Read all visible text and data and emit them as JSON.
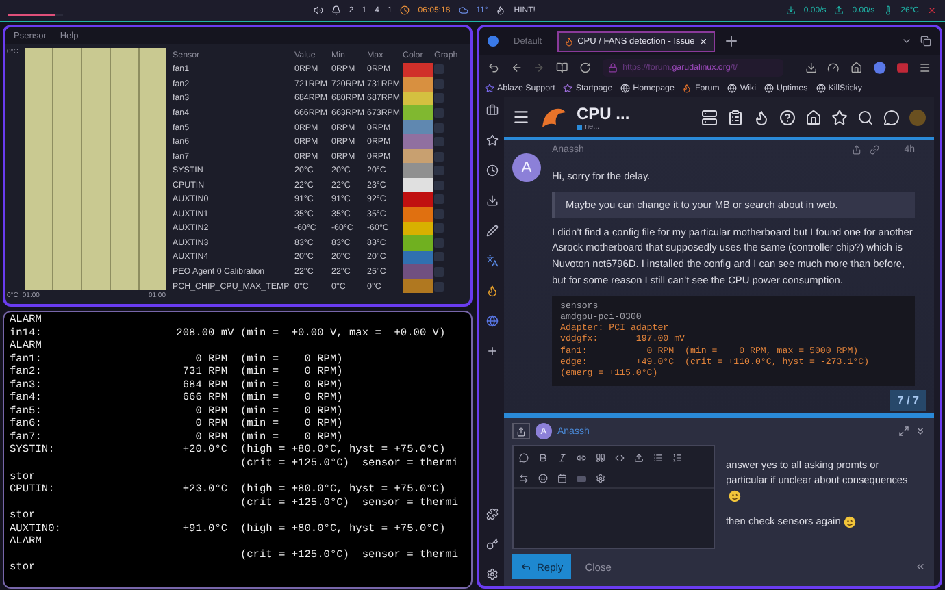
{
  "top_bar": {
    "progress": {
      "level": 0.85
    },
    "workspaces": [
      "2",
      "1",
      "4",
      "1"
    ],
    "clock": "06:05:18",
    "weather": "11°",
    "hint": "HINT!",
    "net_down": "0.00/s",
    "net_up": "0.00/s",
    "temperature": "26°C"
  },
  "psensor": {
    "menu": [
      "Psensor",
      "Help"
    ],
    "graph": {
      "y_top": "0°C",
      "y_bottom": "0°C",
      "x_start": "01:00",
      "x_end": "01:00"
    },
    "columns": [
      "Sensor",
      "Value",
      "Min",
      "Max",
      "Color",
      "Graph"
    ],
    "rows": [
      {
        "sensor": "fan1",
        "value": "0RPM",
        "min": "0RPM",
        "max": "0RPM",
        "color": "#d0302a",
        "graph": false
      },
      {
        "sensor": "fan2",
        "value": "721RPM",
        "min": "720RPM",
        "max": "731RPM",
        "color": "#d89040",
        "graph": false
      },
      {
        "sensor": "fan3",
        "value": "684RPM",
        "min": "680RPM",
        "max": "687RPM",
        "color": "#d4c040",
        "graph": false
      },
      {
        "sensor": "fan4",
        "value": "666RPM",
        "min": "663RPM",
        "max": "673RPM",
        "color": "#80b830",
        "graph": false
      },
      {
        "sensor": "fan5",
        "value": "0RPM",
        "min": "0RPM",
        "max": "0RPM",
        "color": "#6088b0",
        "graph": false
      },
      {
        "sensor": "fan6",
        "value": "0RPM",
        "min": "0RPM",
        "max": "0RPM",
        "color": "#9070a0",
        "graph": false
      },
      {
        "sensor": "fan7",
        "value": "0RPM",
        "min": "0RPM",
        "max": "0RPM",
        "color": "#c8a070",
        "graph": false
      },
      {
        "sensor": "SYSTIN",
        "value": "20°C",
        "min": "20°C",
        "max": "20°C",
        "color": "#909090",
        "graph": false
      },
      {
        "sensor": "CPUTIN",
        "value": "22°C",
        "min": "22°C",
        "max": "23°C",
        "color": "#e0e0e0",
        "graph": false
      },
      {
        "sensor": "AUXTIN0",
        "value": "91°C",
        "min": "91°C",
        "max": "92°C",
        "color": "#c01010",
        "graph": false
      },
      {
        "sensor": "AUXTIN1",
        "value": "35°C",
        "min": "35°C",
        "max": "35°C",
        "color": "#e07010",
        "graph": false
      },
      {
        "sensor": "AUXTIN2",
        "value": "-60°C",
        "min": "-60°C",
        "max": "-60°C",
        "color": "#d8b000",
        "graph": false
      },
      {
        "sensor": "AUXTIN3",
        "value": "83°C",
        "min": "83°C",
        "max": "83°C",
        "color": "#70b020",
        "graph": false
      },
      {
        "sensor": "AUXTIN4",
        "value": "20°C",
        "min": "20°C",
        "max": "20°C",
        "color": "#3070b0",
        "graph": false
      },
      {
        "sensor": "PEO Agent 0 Calibration",
        "value": "22°C",
        "min": "22°C",
        "max": "25°C",
        "color": "#705080",
        "graph": false
      },
      {
        "sensor": "PCH_CHIP_CPU_MAX_TEMP",
        "value": "0°C",
        "min": "0°C",
        "max": "0°C",
        "color": "#b07820",
        "graph": false
      }
    ]
  },
  "terminal": {
    "lines": [
      "ALARM",
      "in14:                     208.00 mV (min =  +0.00 V, max =  +0.00 V)",
      "ALARM",
      "fan1:                        0 RPM  (min =    0 RPM)",
      "fan2:                      731 RPM  (min =    0 RPM)",
      "fan3:                      684 RPM  (min =    0 RPM)",
      "fan4:                      666 RPM  (min =    0 RPM)",
      "fan5:                        0 RPM  (min =    0 RPM)",
      "fan6:                        0 RPM  (min =    0 RPM)",
      "fan7:                        0 RPM  (min =    0 RPM)",
      "SYSTIN:                    +20.0°C  (high = +80.0°C, hyst = +75.0°C)",
      "                                    (crit = +125.0°C)  sensor = thermi",
      "stor",
      "CPUTIN:                    +23.0°C  (high = +80.0°C, hyst = +75.0°C)",
      "                                    (crit = +125.0°C)  sensor = thermi",
      "stor",
      "AUXTIN0:                   +91.0°C  (high = +80.0°C, hyst = +75.0°C)",
      "ALARM",
      "                                    (crit = +125.0°C)  sensor = thermi",
      "stor"
    ]
  },
  "browser": {
    "tabs": [
      {
        "label": "Default",
        "selected": false
      },
      {
        "label": "CPU / FANS detection - Issue",
        "selected": true
      }
    ],
    "url": "https://forum.**garudalinux.org**/t/",
    "bookmarks": [
      "Ablaze Support",
      "Startpage",
      "Homepage",
      "Forum",
      "Wiki",
      "Uptimes",
      "KillSticky"
    ],
    "site": {
      "title": "CPU ...",
      "subtitle": "ne..."
    },
    "post": {
      "avatar": "A",
      "author": "Anassh",
      "time": "4h",
      "greeting": "Hi, sorry for the delay.",
      "quote": "Maybe you can change it to your MB or search about in web.",
      "paragraph": "I didn’t find a config file for my particular motherboard but I found one for another Asrock motherboard that supposedly uses the same (controller chip?) which is Nuvoton nct6796D. I installed the config and I can see much more than before, but for some reason I still can’t see the CPU power consumption.",
      "code": [
        {
          "text": "sensors",
          "kind": "command"
        },
        {
          "text": "amdgpu-pci-0300",
          "kind": "command"
        },
        {
          "text": "Adapter: PCI adapter",
          "kind": "output"
        },
        {
          "text": "vddgfx:       197.00 mV",
          "kind": "output"
        },
        {
          "text": "fan1:           0 RPM  (min =    0 RPM, max = 5000 RPM)",
          "kind": "output"
        },
        {
          "text": "edge:         +49.0°C  (crit = +110.0°C, hyst = -273.1°C)",
          "kind": "output"
        },
        {
          "text": "(emerg = +115.0°C)",
          "kind": "output"
        }
      ],
      "progress": "7 / 7"
    },
    "composer": {
      "avatar": "A",
      "author": "Anassh",
      "preview": [
        "answer yes to all asking promts or particular if unclear about consequences",
        "then check sensors again"
      ],
      "reply": "Reply",
      "close": "Close"
    }
  }
}
